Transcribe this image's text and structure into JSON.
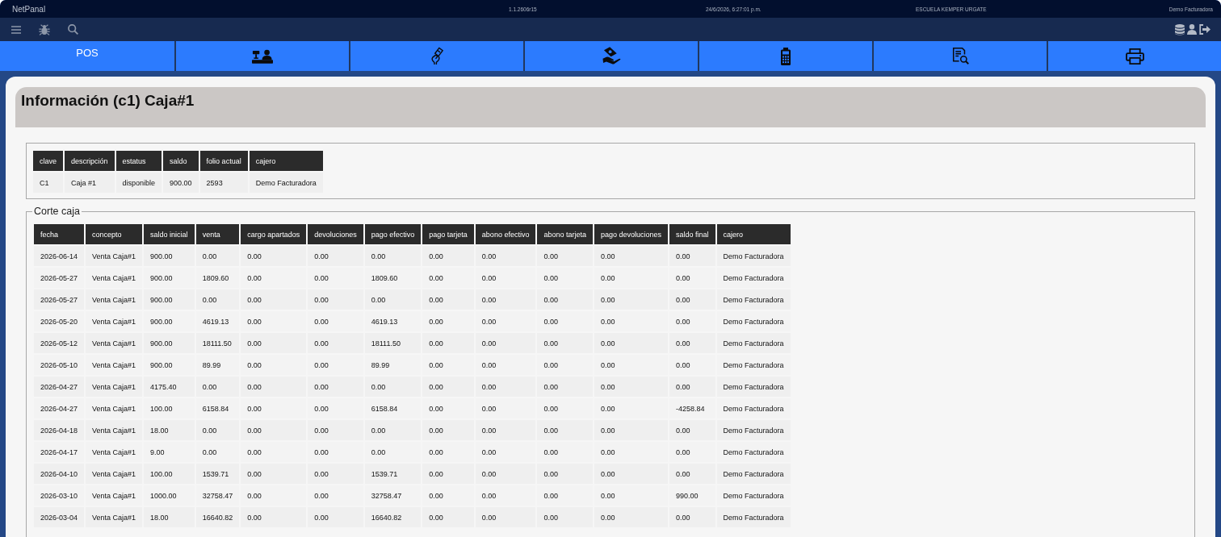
{
  "title_bar": {
    "app_name": "NetPanal",
    "version": "1.1.2606r15",
    "datetime": "24/6/2026, 6:27:01 p.m.",
    "school": "ESCUELA KEMPER URGATE",
    "user": "Demo Facturadora"
  },
  "nav_tabs": [
    {
      "kind": "label",
      "label": "POS"
    },
    {
      "kind": "icon"
    },
    {
      "kind": "icon"
    },
    {
      "kind": "icon"
    },
    {
      "kind": "icon"
    },
    {
      "kind": "icon"
    },
    {
      "kind": "icon"
    }
  ],
  "page": {
    "title": "Información (c1) Caja#1"
  },
  "info_table": {
    "columns": [
      "clave",
      "descripción",
      "estatus",
      "saldo",
      "folio actual",
      "cajero"
    ],
    "rows": [
      [
        "C1",
        "Caja #1",
        "disponible",
        "900.00",
        "2593",
        "Demo Facturadora"
      ]
    ]
  },
  "corte_caja": {
    "legend": "Corte caja",
    "columns": [
      "fecha",
      "concepto",
      "saldo inicial",
      "venta",
      "cargo apartados",
      "devoluciones",
      "pago efectivo",
      "pago tarjeta",
      "abono efectivo",
      "abono tarjeta",
      "pago devoluciones",
      "saldo final",
      "cajero"
    ],
    "rows": [
      [
        "2026-06-14",
        "Venta Caja#1",
        "900.00",
        "0.00",
        "0.00",
        "0.00",
        "0.00",
        "0.00",
        "0.00",
        "0.00",
        "0.00",
        "0.00",
        "Demo Facturadora"
      ],
      [
        "2026-05-27",
        "Venta Caja#1",
        "900.00",
        "1809.60",
        "0.00",
        "0.00",
        "1809.60",
        "0.00",
        "0.00",
        "0.00",
        "0.00",
        "0.00",
        "Demo Facturadora"
      ],
      [
        "2026-05-27",
        "Venta Caja#1",
        "900.00",
        "0.00",
        "0.00",
        "0.00",
        "0.00",
        "0.00",
        "0.00",
        "0.00",
        "0.00",
        "0.00",
        "Demo Facturadora"
      ],
      [
        "2026-05-20",
        "Venta Caja#1",
        "900.00",
        "4619.13",
        "0.00",
        "0.00",
        "4619.13",
        "0.00",
        "0.00",
        "0.00",
        "0.00",
        "0.00",
        "Demo Facturadora"
      ],
      [
        "2026-05-12",
        "Venta Caja#1",
        "900.00",
        "18111.50",
        "0.00",
        "0.00",
        "18111.50",
        "0.00",
        "0.00",
        "0.00",
        "0.00",
        "0.00",
        "Demo Facturadora"
      ],
      [
        "2026-05-10",
        "Venta Caja#1",
        "900.00",
        "89.99",
        "0.00",
        "0.00",
        "89.99",
        "0.00",
        "0.00",
        "0.00",
        "0.00",
        "0.00",
        "Demo Facturadora"
      ],
      [
        "2026-04-27",
        "Venta Caja#1",
        "4175.40",
        "0.00",
        "0.00",
        "0.00",
        "0.00",
        "0.00",
        "0.00",
        "0.00",
        "0.00",
        "0.00",
        "Demo Facturadora"
      ],
      [
        "2026-04-27",
        "Venta Caja#1",
        "100.00",
        "6158.84",
        "0.00",
        "0.00",
        "6158.84",
        "0.00",
        "0.00",
        "0.00",
        "0.00",
        "-4258.84",
        "Demo Facturadora"
      ],
      [
        "2026-04-18",
        "Venta Caja#1",
        "18.00",
        "0.00",
        "0.00",
        "0.00",
        "0.00",
        "0.00",
        "0.00",
        "0.00",
        "0.00",
        "0.00",
        "Demo Facturadora"
      ],
      [
        "2026-04-17",
        "Venta Caja#1",
        "9.00",
        "0.00",
        "0.00",
        "0.00",
        "0.00",
        "0.00",
        "0.00",
        "0.00",
        "0.00",
        "0.00",
        "Demo Facturadora"
      ],
      [
        "2026-04-10",
        "Venta Caja#1",
        "100.00",
        "1539.71",
        "0.00",
        "0.00",
        "1539.71",
        "0.00",
        "0.00",
        "0.00",
        "0.00",
        "0.00",
        "Demo Facturadora"
      ],
      [
        "2026-03-10",
        "Venta Caja#1",
        "1000.00",
        "32758.47",
        "0.00",
        "0.00",
        "32758.47",
        "0.00",
        "0.00",
        "0.00",
        "0.00",
        "990.00",
        "Demo Facturadora"
      ],
      [
        "2026-03-04",
        "Venta Caja#1",
        "18.00",
        "16640.82",
        "0.00",
        "0.00",
        "16640.82",
        "0.00",
        "0.00",
        "0.00",
        "0.00",
        "0.00",
        "Demo Facturadora"
      ]
    ]
  }
}
